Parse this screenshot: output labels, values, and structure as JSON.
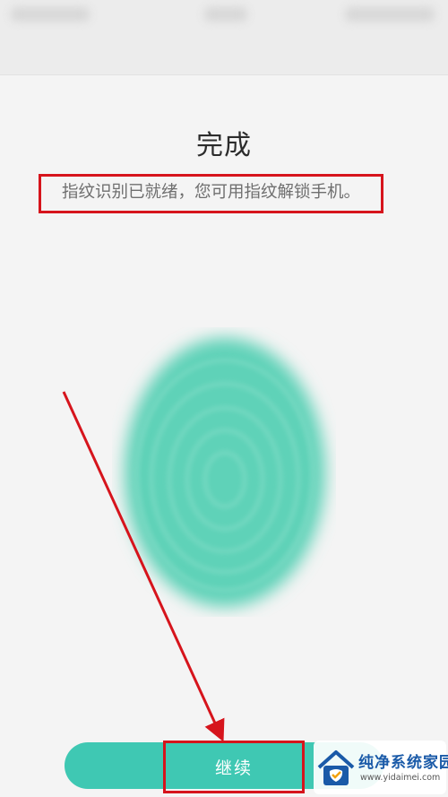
{
  "page": {
    "title": "完成",
    "subtitle": "指纹识别已就绪，您可用指纹解锁手机。"
  },
  "button": {
    "continue_label": "继续"
  },
  "watermark": {
    "brand": "纯净系统家园",
    "url": "www.yidaimei.com"
  },
  "colors": {
    "accent": "#3fc8b3",
    "fingerprint": "#5fd2b8",
    "annotation_red": "#d6141c"
  }
}
